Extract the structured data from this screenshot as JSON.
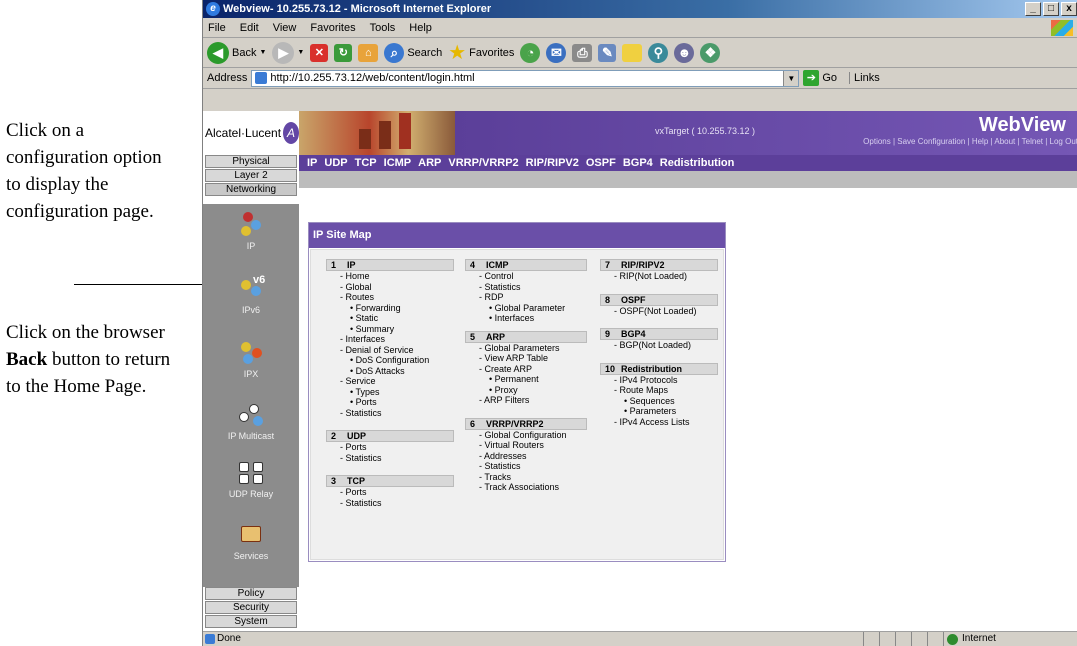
{
  "annotations": {
    "note1": "Click on a configuration option to display the configuration page.",
    "note2_before": "Click on the browser ",
    "note2_bold": "Back",
    "note2_after": " button to return to the Home Page."
  },
  "window": {
    "title": "Webview- 10.255.73.12 - Microsoft Internet Explorer",
    "min": "_",
    "max": "□",
    "close": "x"
  },
  "menu": [
    "File",
    "Edit",
    "View",
    "Favorites",
    "Tools",
    "Help"
  ],
  "toolbar": {
    "back": "Back",
    "search": "Search",
    "favorites": "Favorites"
  },
  "address": {
    "label": "Address",
    "url": "http://10.255.73.12/web/content/login.html",
    "go": "Go",
    "links": "Links"
  },
  "banner": {
    "brand": "Alcatel·Lucent",
    "target": "vxTarget  ( 10.255.73.12 )",
    "title": "WebView",
    "links": "Options  |  Save Configuration  |  Help  |  About  |  Telnet  |  Log Out"
  },
  "left_tabs_top": [
    "Physical",
    "Layer 2",
    "Networking"
  ],
  "left_tabs_bottom": [
    "Policy",
    "Security",
    "System"
  ],
  "subnav": [
    "IP",
    "UDP",
    "TCP",
    "ICMP",
    "ARP",
    "VRRP/VRRP2",
    "RIP/RIPV2",
    "OSPF",
    "BGP4",
    "Redistribution"
  ],
  "sidebar": [
    {
      "label": "IP",
      "icon": "ip-icon"
    },
    {
      "label": "IPv6",
      "icon": "ipv6-icon"
    },
    {
      "label": "IPX",
      "icon": "ipx-icon"
    },
    {
      "label": "IP Multicast",
      "icon": "ip-multicast-icon"
    },
    {
      "label": "UDP Relay",
      "icon": "udp-relay-icon"
    },
    {
      "label": "Services",
      "icon": "services-icon"
    }
  ],
  "sitemap": {
    "title": "IP Site Map",
    "sections": {
      "ip": {
        "num": "1",
        "name": "IP"
      },
      "udp": {
        "num": "2",
        "name": "UDP"
      },
      "tcp": {
        "num": "3",
        "name": "TCP"
      },
      "icmp": {
        "num": "4",
        "name": "ICMP"
      },
      "arp": {
        "num": "5",
        "name": "ARP"
      },
      "vrrp": {
        "num": "6",
        "name": "VRRP/VRRP2"
      },
      "rip": {
        "num": "7",
        "name": "RIP/RIPV2"
      },
      "ospf": {
        "num": "8",
        "name": "OSPF"
      },
      "bgp": {
        "num": "9",
        "name": "BGP4"
      },
      "redist": {
        "num": "10",
        "name": "Redistribution"
      }
    },
    "items": {
      "ip": [
        "- Home",
        "- Global",
        "- Routes",
        "• Forwarding",
        "• Static",
        "• Summary",
        "- Interfaces",
        "- Denial of Service",
        "• DoS Configuration",
        "• DoS Attacks",
        "- Service",
        "• Types",
        "• Ports",
        "- Statistics"
      ],
      "udp": [
        "- Ports",
        "- Statistics"
      ],
      "tcp": [
        "- Ports",
        "- Statistics"
      ],
      "icmp": [
        "- Control",
        "- Statistics",
        "- RDP",
        "• Global Parameter",
        "• Interfaces"
      ],
      "arp": [
        "- Global Parameters",
        "- View ARP Table",
        "- Create ARP",
        "• Permanent",
        "• Proxy",
        "- ARP Filters"
      ],
      "vrrp": [
        "- Global Configuration",
        "- Virtual Routers",
        "- Addresses",
        "- Statistics",
        "- Tracks",
        "- Track Associations"
      ],
      "rip": [
        "- RIP(Not Loaded)"
      ],
      "ospf": [
        "- OSPF(Not Loaded)"
      ],
      "bgp": [
        "- BGP(Not Loaded)"
      ],
      "redist": [
        "- IPv4 Protocols",
        "- Route Maps",
        "• Sequences",
        "• Parameters",
        "- IPv4 Access Lists"
      ]
    }
  },
  "status": {
    "left": "Done",
    "zone": "Internet"
  }
}
